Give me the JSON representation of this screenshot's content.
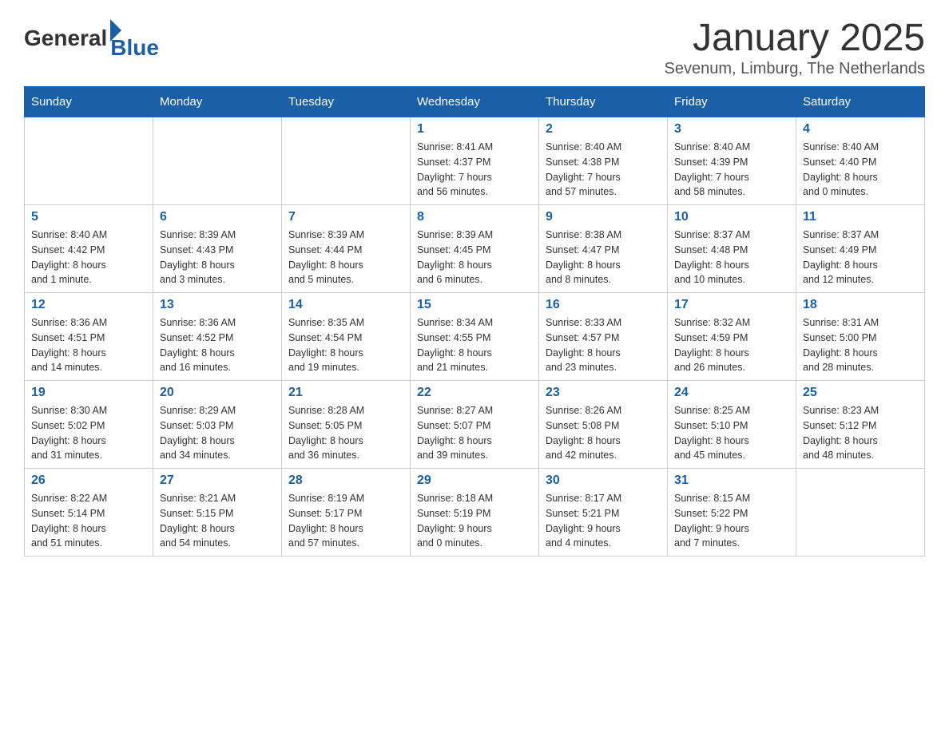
{
  "header": {
    "logo_general": "General",
    "logo_blue": "Blue",
    "month_title": "January 2025",
    "subtitle": "Sevenum, Limburg, The Netherlands"
  },
  "weekdays": [
    "Sunday",
    "Monday",
    "Tuesday",
    "Wednesday",
    "Thursday",
    "Friday",
    "Saturday"
  ],
  "weeks": [
    [
      {
        "day": "",
        "info": ""
      },
      {
        "day": "",
        "info": ""
      },
      {
        "day": "",
        "info": ""
      },
      {
        "day": "1",
        "info": "Sunrise: 8:41 AM\nSunset: 4:37 PM\nDaylight: 7 hours\nand 56 minutes."
      },
      {
        "day": "2",
        "info": "Sunrise: 8:40 AM\nSunset: 4:38 PM\nDaylight: 7 hours\nand 57 minutes."
      },
      {
        "day": "3",
        "info": "Sunrise: 8:40 AM\nSunset: 4:39 PM\nDaylight: 7 hours\nand 58 minutes."
      },
      {
        "day": "4",
        "info": "Sunrise: 8:40 AM\nSunset: 4:40 PM\nDaylight: 8 hours\nand 0 minutes."
      }
    ],
    [
      {
        "day": "5",
        "info": "Sunrise: 8:40 AM\nSunset: 4:42 PM\nDaylight: 8 hours\nand 1 minute."
      },
      {
        "day": "6",
        "info": "Sunrise: 8:39 AM\nSunset: 4:43 PM\nDaylight: 8 hours\nand 3 minutes."
      },
      {
        "day": "7",
        "info": "Sunrise: 8:39 AM\nSunset: 4:44 PM\nDaylight: 8 hours\nand 5 minutes."
      },
      {
        "day": "8",
        "info": "Sunrise: 8:39 AM\nSunset: 4:45 PM\nDaylight: 8 hours\nand 6 minutes."
      },
      {
        "day": "9",
        "info": "Sunrise: 8:38 AM\nSunset: 4:47 PM\nDaylight: 8 hours\nand 8 minutes."
      },
      {
        "day": "10",
        "info": "Sunrise: 8:37 AM\nSunset: 4:48 PM\nDaylight: 8 hours\nand 10 minutes."
      },
      {
        "day": "11",
        "info": "Sunrise: 8:37 AM\nSunset: 4:49 PM\nDaylight: 8 hours\nand 12 minutes."
      }
    ],
    [
      {
        "day": "12",
        "info": "Sunrise: 8:36 AM\nSunset: 4:51 PM\nDaylight: 8 hours\nand 14 minutes."
      },
      {
        "day": "13",
        "info": "Sunrise: 8:36 AM\nSunset: 4:52 PM\nDaylight: 8 hours\nand 16 minutes."
      },
      {
        "day": "14",
        "info": "Sunrise: 8:35 AM\nSunset: 4:54 PM\nDaylight: 8 hours\nand 19 minutes."
      },
      {
        "day": "15",
        "info": "Sunrise: 8:34 AM\nSunset: 4:55 PM\nDaylight: 8 hours\nand 21 minutes."
      },
      {
        "day": "16",
        "info": "Sunrise: 8:33 AM\nSunset: 4:57 PM\nDaylight: 8 hours\nand 23 minutes."
      },
      {
        "day": "17",
        "info": "Sunrise: 8:32 AM\nSunset: 4:59 PM\nDaylight: 8 hours\nand 26 minutes."
      },
      {
        "day": "18",
        "info": "Sunrise: 8:31 AM\nSunset: 5:00 PM\nDaylight: 8 hours\nand 28 minutes."
      }
    ],
    [
      {
        "day": "19",
        "info": "Sunrise: 8:30 AM\nSunset: 5:02 PM\nDaylight: 8 hours\nand 31 minutes."
      },
      {
        "day": "20",
        "info": "Sunrise: 8:29 AM\nSunset: 5:03 PM\nDaylight: 8 hours\nand 34 minutes."
      },
      {
        "day": "21",
        "info": "Sunrise: 8:28 AM\nSunset: 5:05 PM\nDaylight: 8 hours\nand 36 minutes."
      },
      {
        "day": "22",
        "info": "Sunrise: 8:27 AM\nSunset: 5:07 PM\nDaylight: 8 hours\nand 39 minutes."
      },
      {
        "day": "23",
        "info": "Sunrise: 8:26 AM\nSunset: 5:08 PM\nDaylight: 8 hours\nand 42 minutes."
      },
      {
        "day": "24",
        "info": "Sunrise: 8:25 AM\nSunset: 5:10 PM\nDaylight: 8 hours\nand 45 minutes."
      },
      {
        "day": "25",
        "info": "Sunrise: 8:23 AM\nSunset: 5:12 PM\nDaylight: 8 hours\nand 48 minutes."
      }
    ],
    [
      {
        "day": "26",
        "info": "Sunrise: 8:22 AM\nSunset: 5:14 PM\nDaylight: 8 hours\nand 51 minutes."
      },
      {
        "day": "27",
        "info": "Sunrise: 8:21 AM\nSunset: 5:15 PM\nDaylight: 8 hours\nand 54 minutes."
      },
      {
        "day": "28",
        "info": "Sunrise: 8:19 AM\nSunset: 5:17 PM\nDaylight: 8 hours\nand 57 minutes."
      },
      {
        "day": "29",
        "info": "Sunrise: 8:18 AM\nSunset: 5:19 PM\nDaylight: 9 hours\nand 0 minutes."
      },
      {
        "day": "30",
        "info": "Sunrise: 8:17 AM\nSunset: 5:21 PM\nDaylight: 9 hours\nand 4 minutes."
      },
      {
        "day": "31",
        "info": "Sunrise: 8:15 AM\nSunset: 5:22 PM\nDaylight: 9 hours\nand 7 minutes."
      },
      {
        "day": "",
        "info": ""
      }
    ]
  ]
}
